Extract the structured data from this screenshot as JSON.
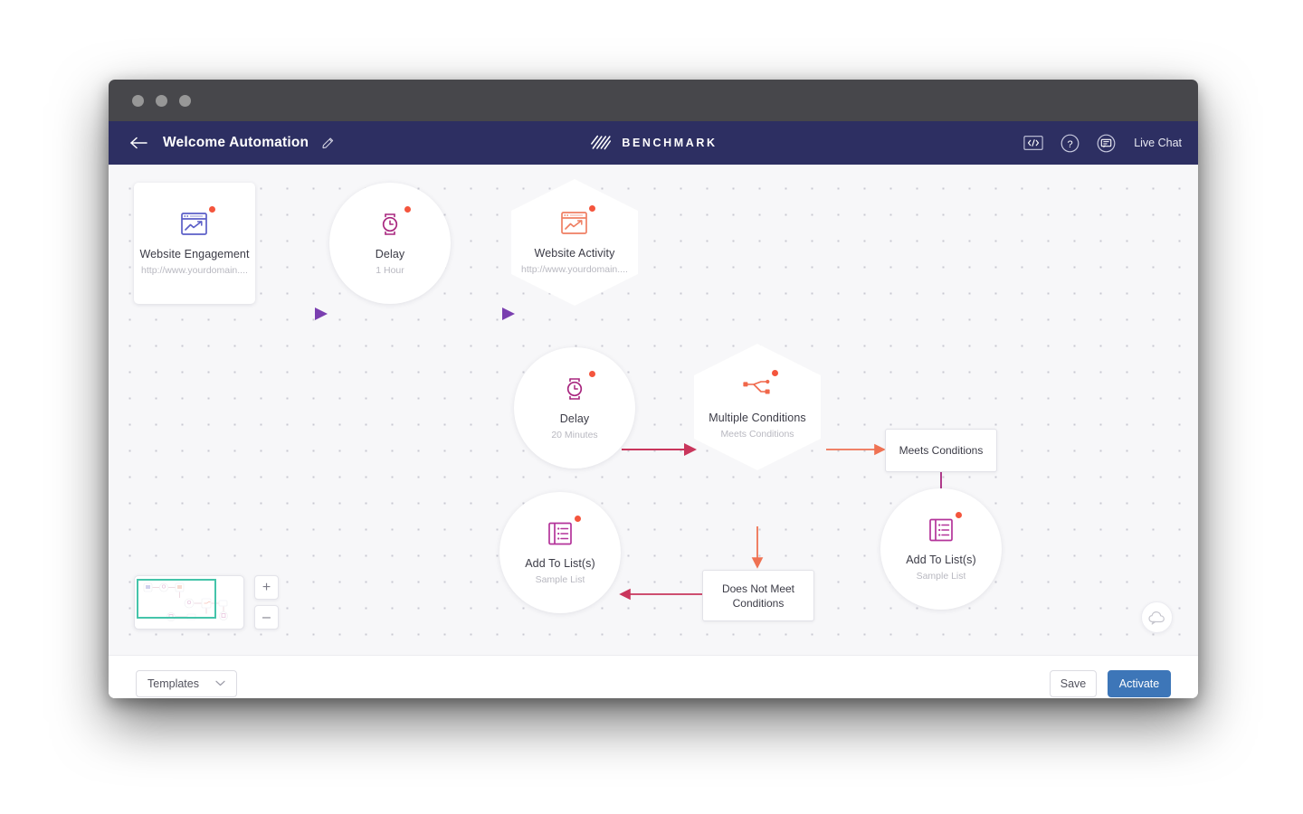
{
  "window": {
    "traffic_lights": [
      "close",
      "minimize",
      "maximize"
    ]
  },
  "header": {
    "back_icon": "back-arrow-icon",
    "title": "Welcome Automation",
    "edit_icon": "pencil-icon",
    "brand": {
      "logo_icon": "benchmark-stripes-logo",
      "name": "BENCHMARK"
    },
    "actions": {
      "code_icon": "code-brackets-icon",
      "help_icon": "question-mark-icon",
      "chat_icon": "chat-bubble-icon",
      "live_chat_label": "Live Chat"
    },
    "background_color": "#2d2f62"
  },
  "canvas": {
    "nodes": [
      {
        "id": "website-engagement",
        "shape": "square",
        "icon": "browser-chart-icon",
        "icon_color": "#5b5ec7",
        "title": "Website Engagement",
        "subtitle": "http://www.yourdomain....",
        "badge": true
      },
      {
        "id": "delay-1-hour",
        "shape": "circle",
        "icon": "watch-icon",
        "icon_color": "#a8267f",
        "title": "Delay",
        "subtitle": "1 Hour",
        "badge": true
      },
      {
        "id": "website-activity",
        "shape": "hexagon",
        "icon": "browser-chart-icon",
        "icon_color": "#ef7f63",
        "title": "Website Activity",
        "subtitle": "http://www.yourdomain....",
        "badge": true
      },
      {
        "id": "delay-20-minutes",
        "shape": "circle",
        "icon": "watch-icon",
        "icon_color": "#a8267f",
        "title": "Delay",
        "subtitle": "20 Minutes",
        "badge": true
      },
      {
        "id": "multiple-conditions",
        "shape": "hexagon",
        "icon": "branch-split-icon",
        "icon_color": "#f0674a",
        "title": "Multiple Conditions",
        "subtitle": "Meets Conditions",
        "badge": true
      },
      {
        "id": "add-to-lists-left",
        "shape": "circle",
        "icon": "list-icon",
        "icon_color": "#b4339a",
        "title": "Add To List(s)",
        "subtitle": "Sample List",
        "badge": true
      },
      {
        "id": "add-to-lists-right",
        "shape": "circle",
        "icon": "list-icon",
        "icon_color": "#b4339a",
        "title": "Add To List(s)",
        "subtitle": "Sample List",
        "badge": true
      }
    ],
    "labels": [
      {
        "id": "meets-conditions",
        "text": "Meets Conditions"
      },
      {
        "id": "does-not-meet-conditions",
        "line1": "Does Not Meet",
        "line2": "Conditions"
      }
    ],
    "controls": {
      "minimap_name": "minimap",
      "zoom_in": "+",
      "zoom_out": "–",
      "help_bubble_icon": "cloud-chat-icon"
    },
    "edge_colors": {
      "purple": "#7a3fb0",
      "crimson": "#c9365c",
      "orange": "#ef7253"
    }
  },
  "footer": {
    "templates_label": "Templates",
    "templates_caret": "chevron-down-icon",
    "save_label": "Save",
    "activate_label": "Activate",
    "activate_color": "#3d76b8"
  }
}
